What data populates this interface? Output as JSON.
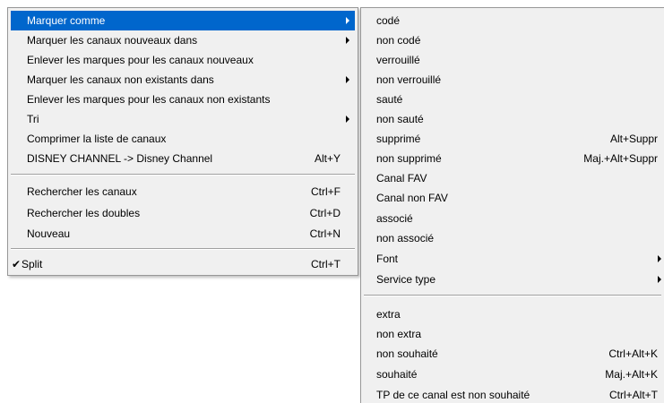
{
  "colors": {
    "menu_bg": "#f0f0f0",
    "highlight": "#0066cc",
    "border": "#979797"
  },
  "main_menu": {
    "mark_as": {
      "label": "Marquer comme",
      "submenu": true
    },
    "mark_new_in": {
      "label": "Marquer les canaux nouveaux dans",
      "submenu": true
    },
    "remove_new_marks": {
      "label": "Enlever les marques pour les canaux nouveaux"
    },
    "mark_nonexistent_in": {
      "label": "Marquer les canaux non existants dans",
      "submenu": true
    },
    "remove_nonexistent_marks": {
      "label": "Enlever les marques pour les canaux non existants"
    },
    "sort": {
      "label": "Tri",
      "submenu": true
    },
    "compress": {
      "label": "Comprimer la liste de canaux"
    },
    "rename": {
      "label": "DISNEY CHANNEL -> Disney Channel",
      "shortcut": "Alt+Y"
    },
    "search_channels": {
      "label": "Rechercher les canaux",
      "shortcut": "Ctrl+F"
    },
    "search_duplicates": {
      "label": "Rechercher les doubles",
      "shortcut": "Ctrl+D"
    },
    "new": {
      "label": "Nouveau",
      "shortcut": "Ctrl+N"
    },
    "split": {
      "label": "Split",
      "shortcut": "Ctrl+T",
      "checked": true,
      "check_glyph": "✔"
    }
  },
  "sub_menu": {
    "coded": {
      "label": "codé"
    },
    "not_coded": {
      "label": "non codé"
    },
    "locked": {
      "label": "verrouillé"
    },
    "not_locked": {
      "label": "non verrouillé"
    },
    "skipped": {
      "label": "sauté"
    },
    "not_skipped": {
      "label": "non sauté"
    },
    "deleted": {
      "label": "supprimé",
      "shortcut": "Alt+Suppr"
    },
    "not_deleted": {
      "label": "non supprimé",
      "shortcut": "Maj.+Alt+Suppr"
    },
    "fav": {
      "label": "Canal FAV"
    },
    "not_fav": {
      "label": "Canal non FAV"
    },
    "associated": {
      "label": "associé"
    },
    "not_associated": {
      "label": "non associé"
    },
    "font": {
      "label": "Font",
      "submenu": true
    },
    "service_type": {
      "label": "Service type",
      "submenu": true
    },
    "extra": {
      "label": "extra"
    },
    "not_extra": {
      "label": "non extra"
    },
    "unwanted": {
      "label": "non souhaité",
      "shortcut": "Ctrl+Alt+K"
    },
    "wanted": {
      "label": "souhaité",
      "shortcut": "Maj.+Alt+K"
    },
    "tp_unwanted": {
      "label": "TP de ce canal est non souhaité",
      "shortcut": "Ctrl+Alt+T"
    }
  }
}
